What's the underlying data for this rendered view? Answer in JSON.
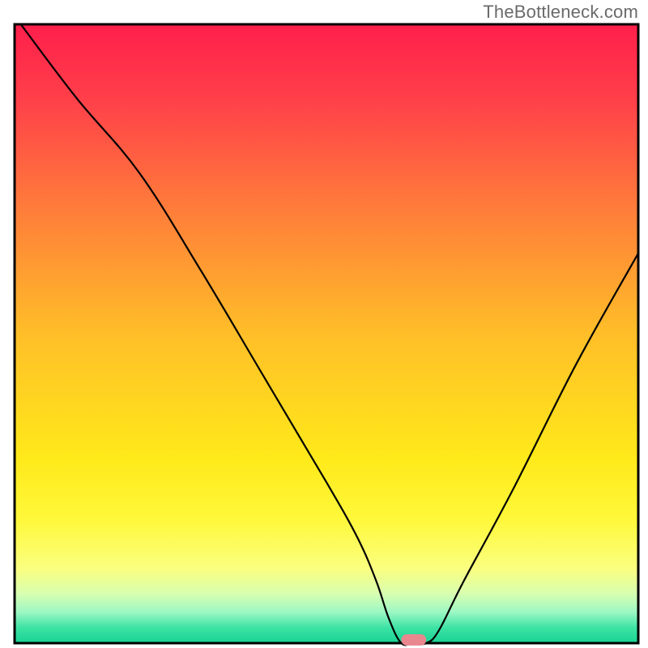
{
  "watermark": "TheBottleneck.com",
  "chart_data": {
    "type": "line",
    "title": "",
    "xlabel": "",
    "ylabel": "",
    "xlim": [
      0,
      100
    ],
    "ylim": [
      0,
      100
    ],
    "grid": false,
    "legend": false,
    "series": [
      {
        "name": "bottleneck-curve",
        "x": [
          1,
          10,
          20,
          30,
          40,
          50,
          55,
          58,
          60,
          62,
          64,
          66,
          68,
          72,
          80,
          90,
          100
        ],
        "values": [
          100,
          88,
          76,
          60,
          43,
          26,
          17,
          10,
          4,
          0,
          0,
          0,
          2,
          10,
          25,
          45,
          63
        ]
      }
    ],
    "marker": {
      "name": "optimal-zone",
      "x_start": 62,
      "x_end": 66,
      "y": 0,
      "color": "#e8888e"
    },
    "gradient_stops": [
      {
        "offset": 0.0,
        "color": "#ff1f4b"
      },
      {
        "offset": 0.12,
        "color": "#ff3f4a"
      },
      {
        "offset": 0.3,
        "color": "#ff7d3a"
      },
      {
        "offset": 0.5,
        "color": "#ffbe28"
      },
      {
        "offset": 0.7,
        "color": "#ffe91a"
      },
      {
        "offset": 0.8,
        "color": "#fff83a"
      },
      {
        "offset": 0.88,
        "color": "#faff80"
      },
      {
        "offset": 0.92,
        "color": "#d8ffb0"
      },
      {
        "offset": 0.95,
        "color": "#9cf7c4"
      },
      {
        "offset": 0.975,
        "color": "#3de3a4"
      },
      {
        "offset": 1.0,
        "color": "#18d292"
      }
    ],
    "border_color": "#000000",
    "line_color": "#000000",
    "line_width": 2.2
  }
}
